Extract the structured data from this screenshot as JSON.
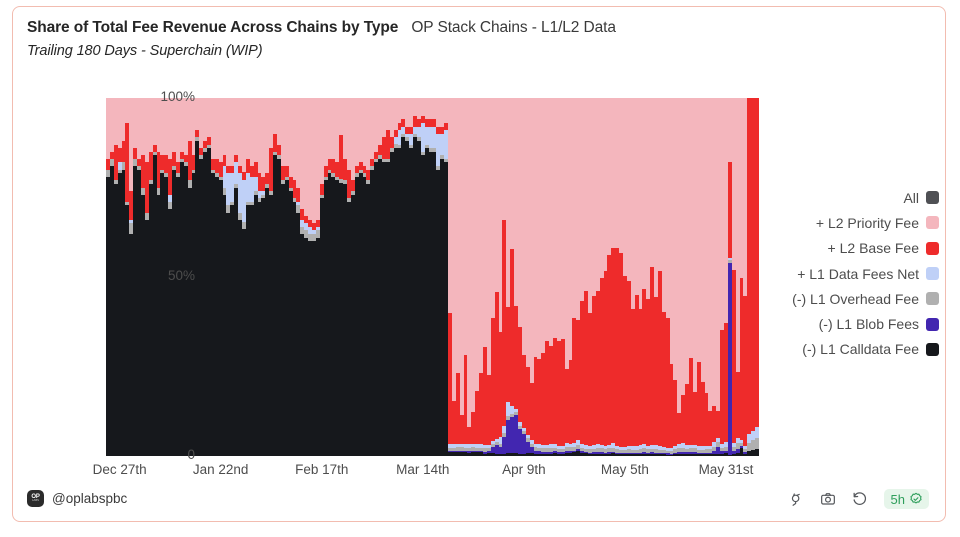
{
  "header": {
    "title": "Share of Total Fee Revenue Across Chains by Type",
    "subtitle_inline": "OP Stack Chains - L1/L2 Data",
    "subtitle": "Trailing 180 Days - Superchain (WIP)"
  },
  "footer": {
    "handle": "@oplabspbc",
    "logo_top": "OP",
    "logo_bottom": "LABS",
    "freshness_label": "5h",
    "icons": [
      {
        "name": "plug-icon"
      },
      {
        "name": "camera-icon"
      },
      {
        "name": "refresh-icon"
      },
      {
        "name": "verified-check-icon"
      }
    ]
  },
  "legend": {
    "position": "right",
    "items": [
      {
        "label": "All",
        "color": "#4f5054"
      },
      {
        "label": "+ L2 Priority Fee",
        "color": "#f4b6bd"
      },
      {
        "label": "+ L2 Base Fee",
        "color": "#ee2b2b"
      },
      {
        "label": "+ L1 Data Fees Net",
        "color": "#bfd0f7"
      },
      {
        "label": "(-) L1 Overhead Fee",
        "color": "#b0b0b0"
      },
      {
        "label": "(-) L1 Blob Fees",
        "color": "#4226b0"
      },
      {
        "label": "(-) L1 Calldata Fee",
        "color": "#16181c"
      }
    ]
  },
  "chart_data": {
    "type": "bar",
    "stacking": "percent",
    "title": "Share of Total Fee Revenue Across Chains by Type",
    "subtitle": "Trailing 180 Days - Superchain (WIP)",
    "xlabel": "",
    "ylabel": "",
    "ylim": [
      0,
      100
    ],
    "ytick_labels": [
      "0",
      "50%",
      "100%"
    ],
    "ytick_values": [
      0,
      50,
      100
    ],
    "xtick_labels": [
      "Dec 27th",
      "Jan 22nd",
      "Feb 17th",
      "Mar 14th",
      "Apr 9th",
      "May 5th",
      "May 31st"
    ],
    "xtick_indices": [
      3,
      29,
      55,
      81,
      107,
      133,
      159
    ],
    "grid": false,
    "legend_position": "right",
    "series_order": [
      "l1_calldata",
      "l1_blob",
      "l1_overhead",
      "l1_data_net",
      "l2_base",
      "l2_priority"
    ],
    "series": [
      {
        "name": "(-) L1 Calldata Fee",
        "color": "#16181c",
        "values": [
          78,
          81,
          76,
          79,
          80,
          70,
          62,
          81,
          80,
          73,
          66,
          76,
          84,
          73,
          79,
          78,
          69,
          80,
          78,
          82,
          81,
          75,
          79,
          88,
          83,
          85,
          86,
          79,
          78,
          77,
          73,
          68,
          70,
          75,
          66,
          64,
          70,
          70,
          73,
          71,
          72,
          75,
          73,
          84,
          83,
          76,
          77,
          74,
          71,
          68,
          62,
          61,
          60,
          60,
          61,
          72,
          77,
          79,
          78,
          77,
          74,
          76,
          71,
          73,
          78,
          79,
          78,
          76,
          80,
          82,
          83,
          82,
          82,
          85,
          87,
          86,
          89,
          88,
          86,
          89,
          88,
          84,
          86,
          85,
          85,
          80,
          83,
          82,
          1,
          1,
          1,
          1,
          1,
          0.8,
          1,
          1,
          1,
          0.7,
          0.9,
          1,
          0.7,
          0.6,
          0.6,
          0.9,
          0.9,
          0.8,
          0.6,
          0.5,
          0.7,
          0.8,
          0.6,
          0.6,
          0.7,
          0.7,
          0.6,
          0.7,
          0.7,
          0.7,
          0.8,
          0.9,
          1,
          1.2,
          1,
          0.8,
          0.6,
          0.6,
          0.5,
          0.6,
          0.6,
          0.6,
          0.6,
          0.5,
          0.5,
          0.6,
          0.6,
          0.5,
          0.5,
          0.5,
          0.6,
          0.6,
          0.6,
          0.5,
          0.5,
          0.5,
          0.5,
          0.4,
          0.5,
          0.5,
          0.6,
          0.6,
          0.6,
          0.5,
          0.5,
          0.5,
          0.5,
          0.5,
          0.5,
          0.5,
          0.6,
          0.6,
          0.5,
          0.5,
          0.6,
          2.5,
          0.6,
          0.6,
          0.6,
          0.6
        ]
      },
      {
        "name": "(-) L1 Blob Fees",
        "color": "#4226b0",
        "values": [
          0,
          0,
          0,
          0,
          0,
          0,
          0,
          0,
          0,
          0,
          0,
          0,
          0,
          0,
          0,
          0,
          0,
          0,
          0,
          0,
          0,
          0,
          0,
          0,
          0,
          0,
          0,
          0,
          0,
          0,
          0,
          0,
          0,
          0,
          0,
          0,
          0,
          0,
          0,
          0,
          0,
          0,
          0,
          0,
          0,
          0,
          0,
          0,
          0,
          0,
          0,
          0,
          0,
          0,
          0,
          0,
          0,
          0,
          0,
          0,
          0,
          0,
          0,
          0,
          0,
          0,
          0,
          0,
          0,
          0,
          0,
          0,
          0,
          0,
          0,
          0,
          0,
          0,
          0,
          0,
          0,
          0,
          0,
          0,
          0,
          0,
          0,
          0,
          0.4,
          0.4,
          0.5,
          0.5,
          0.4,
          0.5,
          0.5,
          0.4,
          0.4,
          0.5,
          0.6,
          1.5,
          3,
          2,
          5,
          9,
          13,
          12,
          8,
          6,
          3,
          1.5,
          0.8,
          0.6,
          0.5,
          0.5,
          0.5,
          0.5,
          0.5,
          0.4,
          0.4,
          0.4,
          0.4,
          0.4,
          0.4,
          0.4,
          0.4,
          0.4,
          0.4,
          0.4,
          0.4,
          0.4,
          0.4,
          0.4,
          0.4,
          0.4,
          0.4,
          0.4,
          0.4,
          0.4,
          0.4,
          0.4,
          0.4,
          0.4,
          0.4,
          0.4,
          0.4,
          0.4,
          0.5,
          0.5,
          0.5,
          0.5,
          0.5,
          0.5,
          0.5,
          0.5,
          0.5,
          0.5,
          0.5,
          1.5,
          0.6,
          0.6,
          72,
          0.8,
          0.7,
          0.7,
          0.7
        ]
      },
      {
        "name": "(-) L1 Overhead Fee",
        "color": "#b0b0b0",
        "values": [
          2,
          2,
          1,
          1,
          2,
          1,
          3,
          2,
          1,
          2,
          2,
          1,
          1,
          2,
          1,
          1,
          2,
          1,
          1,
          1,
          1,
          2,
          1,
          1,
          1,
          1,
          1,
          1,
          1,
          1,
          2,
          2,
          1,
          1,
          2,
          2,
          1,
          1,
          1,
          1,
          1,
          1,
          1,
          1,
          1,
          1,
          1,
          1,
          1,
          2,
          2,
          2,
          2,
          2,
          2,
          1,
          1,
          1,
          1,
          1,
          1,
          1,
          1,
          1,
          1,
          1,
          1,
          1,
          1,
          1,
          1,
          1,
          1,
          1,
          1,
          1,
          1,
          1,
          1,
          1,
          1,
          1,
          1,
          1,
          1,
          1,
          1,
          1,
          1,
          1,
          1,
          1,
          1,
          1,
          1,
          1,
          1,
          1,
          1,
          1,
          1,
          1,
          1,
          1,
          1,
          1,
          1,
          1,
          1,
          1,
          1,
          1,
          1,
          1,
          1,
          1,
          1,
          1,
          1,
          1,
          1,
          1,
          1,
          1,
          1,
          1,
          1,
          1,
          1,
          1,
          1,
          1,
          1,
          1,
          1,
          1,
          1,
          1,
          1,
          1,
          1,
          1,
          1,
          1,
          1,
          1,
          1,
          1,
          1,
          1,
          1,
          1,
          1,
          1,
          1,
          1,
          1,
          1,
          1,
          1,
          1,
          1,
          1,
          1,
          1,
          1,
          1,
          1,
          1,
          1
        ]
      },
      {
        "name": "+ L1 Data Fees Net",
        "color": "#bfd0f7",
        "values": [
          0,
          0,
          0,
          2,
          0,
          0,
          1,
          0,
          0,
          0,
          0,
          0,
          0,
          0,
          0,
          0,
          2,
          0,
          0,
          0,
          0,
          0,
          0,
          0,
          0,
          0,
          0,
          0,
          0,
          0,
          6,
          9,
          8,
          6,
          11,
          12,
          8,
          7,
          4,
          2,
          1,
          0,
          0,
          0,
          0,
          0,
          0,
          0,
          0,
          1,
          2,
          2,
          2,
          1,
          1,
          0,
          0,
          0,
          0,
          0,
          0,
          0,
          0,
          0,
          0,
          0,
          0,
          0,
          0,
          0,
          0,
          0,
          0,
          0,
          2,
          4,
          2,
          1,
          3,
          2,
          3,
          8,
          5,
          6,
          6,
          9,
          6,
          8,
          1,
          1,
          1,
          1,
          1,
          1,
          1,
          1,
          1,
          1,
          1,
          1,
          1,
          2,
          2,
          4,
          3,
          1,
          1,
          1,
          1,
          1,
          1,
          1,
          1,
          1,
          1,
          1,
          1,
          1,
          1,
          1,
          1,
          1,
          1,
          1,
          1,
          1,
          1,
          1,
          1,
          1,
          1,
          1,
          1,
          1,
          1,
          1,
          1,
          1,
          1,
          1,
          1,
          1,
          1,
          1,
          1,
          1,
          1,
          1,
          1,
          1,
          1,
          1,
          1,
          1,
          1,
          1,
          1,
          1,
          1,
          1,
          1,
          1,
          1,
          1,
          1,
          1,
          1,
          1,
          1
        ]
      },
      {
        "name": "+ L2 Base Fee",
        "color": "#ee2b2b",
        "values": [
          3,
          2,
          10,
          4,
          6,
          22,
          8,
          3,
          2,
          9,
          14,
          8,
          2,
          10,
          4,
          5,
          10,
          4,
          3,
          2,
          2,
          11,
          4,
          2,
          2,
          2,
          2,
          3,
          4,
          4,
          3,
          2,
          2,
          2,
          2,
          2,
          4,
          3,
          4,
          5,
          4,
          3,
          12,
          5,
          3,
          4,
          3,
          3,
          5,
          4,
          3,
          2,
          2,
          2,
          2,
          3,
          3,
          3,
          4,
          4,
          12,
          6,
          8,
          3,
          2,
          2,
          2,
          3,
          2,
          2,
          3,
          6,
          8,
          3,
          2,
          2,
          2,
          2,
          2,
          3,
          2,
          2,
          2,
          2,
          2,
          2,
          2,
          2,
          37,
          12,
          20,
          8,
          25,
          5,
          9,
          15,
          20,
          28,
          22,
          36,
          48,
          30,
          60,
          26,
          56,
          32,
          30,
          22,
          18,
          15,
          24,
          22,
          26,
          30,
          25,
          28,
          34,
          33,
          18,
          22,
          32,
          28,
          42,
          46,
          38,
          40,
          36,
          44,
          52,
          50,
          46,
          56,
          62,
          55,
          48,
          40,
          44,
          36,
          40,
          42,
          48,
          40,
          52,
          44,
          46,
          28,
          20,
          8,
          12,
          18,
          24,
          14,
          26,
          20,
          16,
          10,
          8,
          6,
          30,
          28,
          36,
          45,
          12,
          52,
          48,
          40,
          34,
          30
        ]
      },
      {
        "name": "+ L2 Priority Fee",
        "color": "#f4b6bd",
        "values": [
          17,
          15,
          13,
          14,
          12,
          7,
          26,
          14,
          17,
          16,
          18,
          15,
          13,
          15,
          16,
          16,
          17,
          15,
          18,
          15,
          16,
          12,
          16,
          9,
          14,
          12,
          11,
          17,
          17,
          18,
          16,
          19,
          19,
          16,
          19,
          21,
          17,
          19,
          18,
          21,
          22,
          21,
          14,
          10,
          13,
          19,
          19,
          22,
          23,
          25,
          31,
          33,
          34,
          35,
          34,
          24,
          19,
          17,
          17,
          18,
          10,
          17,
          20,
          23,
          19,
          18,
          19,
          20,
          17,
          15,
          13,
          11,
          9,
          11,
          9,
          7,
          6,
          8,
          8,
          5,
          6,
          5,
          6,
          6,
          6,
          8,
          8,
          7,
          60.6,
          85.6,
          77.5,
          89.7,
          72.6,
          92.7,
          88.5,
          82.6,
          77.6,
          70.8,
          87.5,
          64.5,
          63.3,
          67.4,
          35.4,
          57.1,
          54.1,
          65.2,
          72.4,
          77.5,
          71.3,
          75.2,
          71.4,
          67.4,
          72.3,
          69.8,
          63.6,
          63.4,
          78.9,
          74.8,
          65.6,
          69.2,
          56.6,
          51.4,
          59.5,
          57.4,
          61.4,
          53.4,
          45.5,
          47.5,
          51.4,
          41.4,
          35.4,
          42.5,
          49.5,
          57.5,
          53.5,
          61.5,
          57.5,
          55.5,
          49.4,
          57.5,
          45.5,
          53.5,
          51.5,
          69.5,
          77.5,
          89.5,
          85.5,
          79.5,
          73.5,
          83.5,
          71.5,
          77.5,
          81.5,
          87.5,
          89.5,
          91.4,
          67.4,
          69.4,
          61.4,
          52.9,
          23.9,
          44.7,
          49.7,
          57.7,
          63.7
        ]
      }
    ]
  }
}
